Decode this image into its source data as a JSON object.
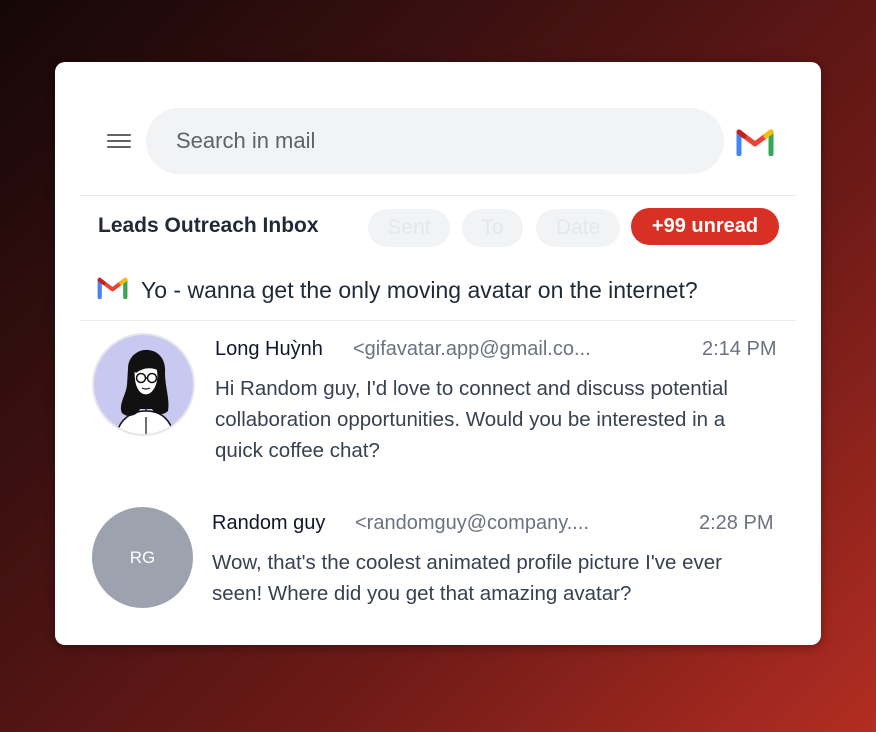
{
  "search": {
    "placeholder": "Search in mail"
  },
  "inbox": {
    "title": "Leads Outreach Inbox",
    "filters": [
      "Sent",
      "To",
      "Date"
    ],
    "unread_label": "+99 unread"
  },
  "thread": {
    "subject": "Yo - wanna get the only moving avatar on the internet?"
  },
  "messages": [
    {
      "sender": "Long Huỳnh",
      "email": "<gifavatar.app@gmail.co...",
      "time": "2:14 PM",
      "body": "Hi Random guy, I'd love to connect and discuss potential collaboration opportunities. Would you be interested in a quick coffee chat?",
      "avatar": "illustrated-person"
    },
    {
      "sender": "Random guy",
      "email": "<randomguy@company....",
      "time": "2:28 PM",
      "body": "Wow, that's the coolest animated profile picture I've ever seen! Where did you get that amazing avatar?",
      "avatar_initials": "RG"
    }
  ],
  "colors": {
    "unread_badge": "#d93025",
    "avatar1_bg": "#c9c8f0",
    "avatar2_bg": "#9ca3af"
  },
  "icons": [
    "menu-icon",
    "gmail-logo-icon"
  ]
}
